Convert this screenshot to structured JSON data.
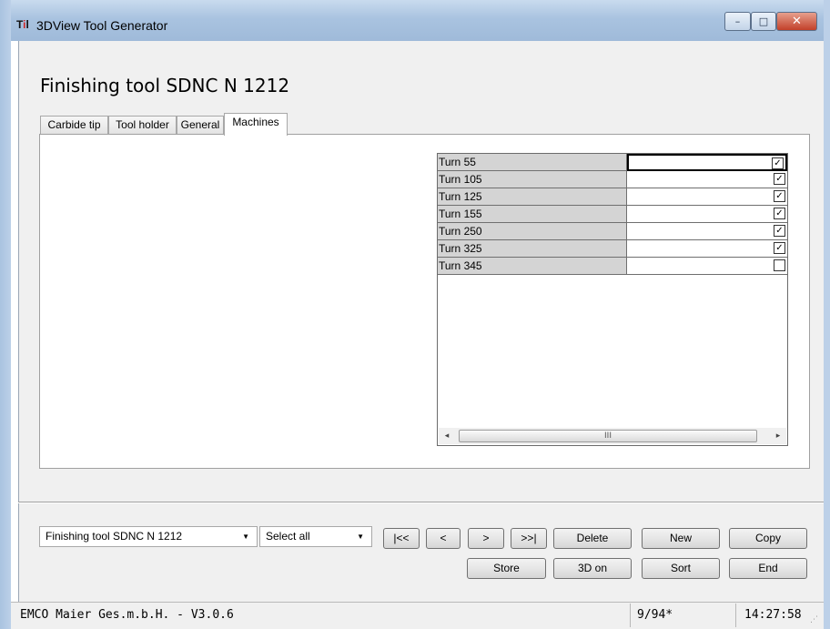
{
  "window": {
    "title": "3DView Tool Generator",
    "minimize_glyph": "–",
    "maximize_glyph": "□",
    "close_glyph": "✕"
  },
  "heading": "Finishing tool SDNC N 1212",
  "tabs": [
    {
      "label": "Carbide tip",
      "active": false
    },
    {
      "label": "Tool holder",
      "active": false
    },
    {
      "label": "General",
      "active": false
    },
    {
      "label": "Machines",
      "active": true
    }
  ],
  "machines": [
    {
      "name": "Turn 55",
      "checked": true,
      "selected": true
    },
    {
      "name": "Turn 105",
      "checked": true,
      "selected": false
    },
    {
      "name": "Turn 125",
      "checked": true,
      "selected": false
    },
    {
      "name": "Turn 155",
      "checked": true,
      "selected": false
    },
    {
      "name": "Turn 250",
      "checked": true,
      "selected": false
    },
    {
      "name": "Turn 325",
      "checked": true,
      "selected": false
    },
    {
      "name": "Turn 345",
      "checked": false,
      "selected": false
    }
  ],
  "scrollbar": {
    "left_arrow": "◂",
    "thumb_grip": "III",
    "right_arrow": "▸"
  },
  "controls": {
    "tool_select": "Finishing tool SDNC N 1212",
    "selection_filter": "Select all",
    "dropdown_arrow": "▼",
    "first": "|<<",
    "prev": "<",
    "next": ">",
    "last": ">>|",
    "delete": "Delete",
    "new": "New",
    "copy": "Copy",
    "store": "Store",
    "view3d": "3D on",
    "sort": "Sort",
    "end": "End"
  },
  "status": {
    "company": "EMCO Maier Ges.m.b.H.  -  V3.0.6",
    "record": "9/94*",
    "time": "14:27:58"
  },
  "icons": {
    "app": "app-logo-icon",
    "check": "✓",
    "resize_grip": "⋰"
  }
}
